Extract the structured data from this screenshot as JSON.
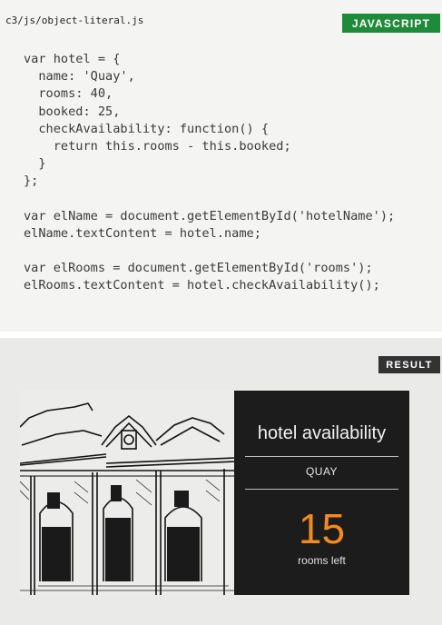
{
  "code_panel": {
    "file_path": "c3/js/object-literal.js",
    "language_label": "JAVASCRIPT",
    "lines": [
      "var hotel = {",
      "  name: 'Quay',",
      "  rooms: 40,",
      "  booked: 25,",
      "  checkAvailability: function() {",
      "    return this.rooms - this.booked;",
      "  }",
      "};",
      "",
      "var elName = document.getElementById('hotelName');",
      "elName.textContent = hotel.name;",
      "",
      "var elRooms = document.getElementById('rooms');",
      "elRooms.textContent = hotel.checkAvailability();"
    ]
  },
  "result_panel": {
    "label": "RESULT",
    "title": "hotel availability",
    "hotel_name": "QUAY",
    "rooms_left": "15",
    "caption": "rooms left"
  },
  "colors": {
    "badge_green": "#1f8a3a",
    "badge_dark": "#333333",
    "count_orange": "#f28a1e"
  }
}
